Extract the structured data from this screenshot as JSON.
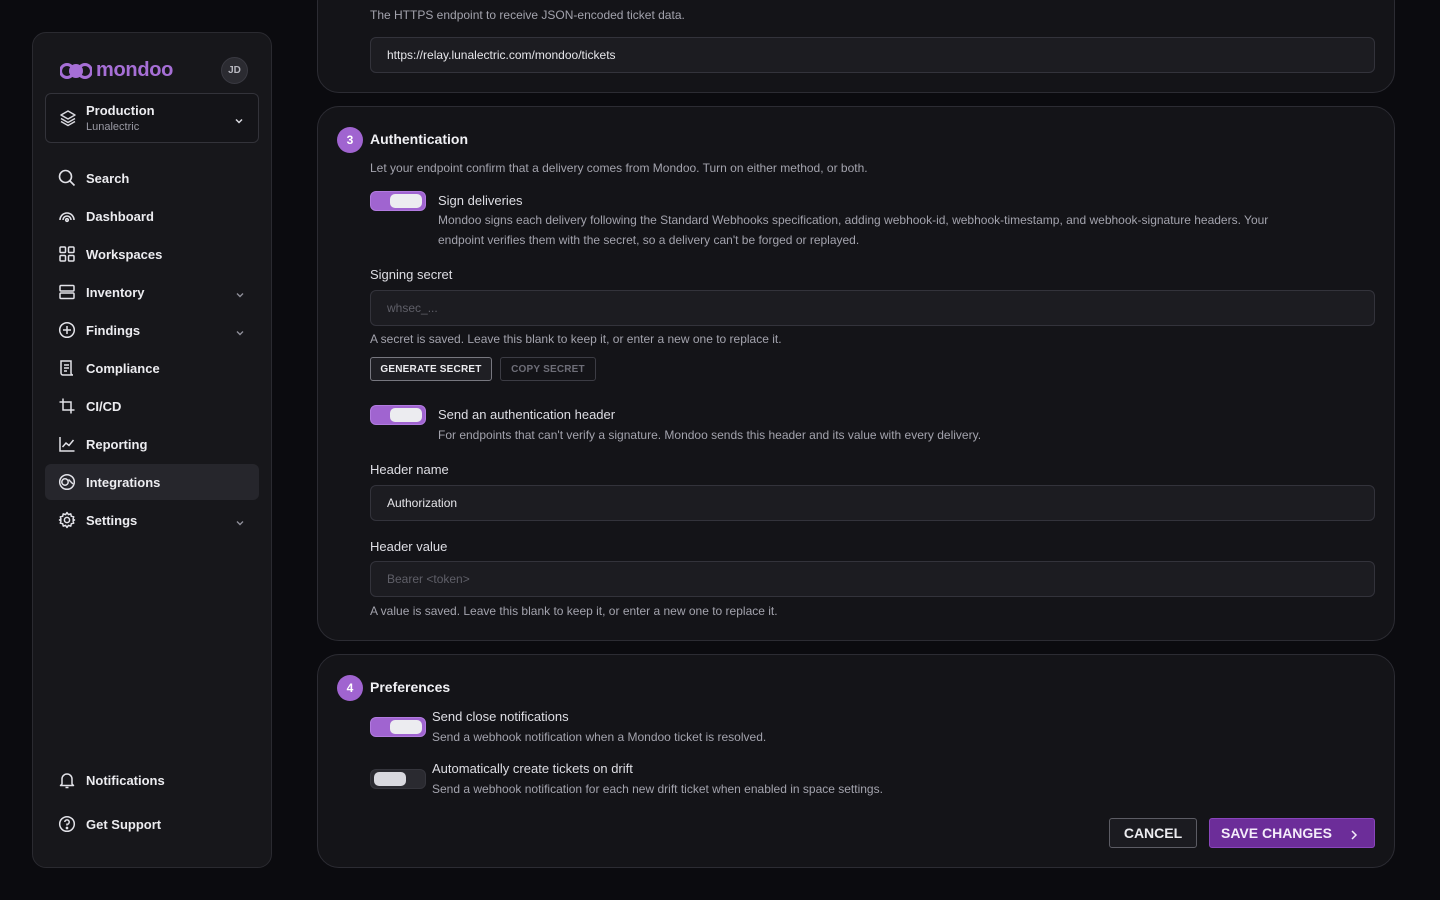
{
  "sidebar": {
    "logo_text": "mondoo",
    "avatar_initials": "JD",
    "space": {
      "name": "Production",
      "org": "Lunalectric"
    },
    "nav": [
      {
        "label": "Search",
        "icon": "search-icon"
      },
      {
        "label": "Dashboard",
        "icon": "dashboard-icon"
      },
      {
        "label": "Workspaces",
        "icon": "grid-icon"
      },
      {
        "label": "Inventory",
        "icon": "server-icon",
        "expandable": true
      },
      {
        "label": "Findings",
        "icon": "plus-circle-icon",
        "expandable": true
      },
      {
        "label": "Compliance",
        "icon": "scroll-icon"
      },
      {
        "label": "CI/CD",
        "icon": "pipeline-icon"
      },
      {
        "label": "Reporting",
        "icon": "line-chart-icon"
      },
      {
        "label": "Integrations",
        "icon": "integrations-icon",
        "active": true
      },
      {
        "label": "Settings",
        "icon": "gear-icon",
        "expandable": true
      }
    ],
    "bottom": [
      {
        "label": "Notifications",
        "icon": "bell-icon"
      },
      {
        "label": "Get Support",
        "icon": "help-circle-icon"
      }
    ]
  },
  "endpoint": {
    "hint": "The HTTPS endpoint to receive JSON-encoded ticket data.",
    "value": "https://relay.lunalectric.com/mondoo/tickets"
  },
  "authentication": {
    "step": "3",
    "title": "Authentication",
    "description": "Let your endpoint confirm that a delivery comes from Mondoo. Turn on either method, or both.",
    "sign": {
      "label": "Sign deliveries",
      "enabled": true,
      "description_line1": "Mondoo signs each delivery following the Standard Webhooks specification, adding webhook-id, webhook-timestamp, and webhook-signature headers. Your",
      "description_line2": "endpoint verifies them with the secret, so a delivery can't be forged or replayed."
    },
    "secret": {
      "label": "Signing secret",
      "placeholder": "whsec_...",
      "hint": "A secret is saved. Leave this blank to keep it, or enter a new one to replace it.",
      "generate_label": "GENERATE SECRET",
      "copy_label": "COPY SECRET"
    },
    "header_auth": {
      "label": "Send an authentication header",
      "enabled": true,
      "description": "For endpoints that can't verify a signature. Mondoo sends this header and its value with every delivery."
    },
    "header_name": {
      "label": "Header name",
      "value": "Authorization"
    },
    "header_value": {
      "label": "Header value",
      "placeholder": "Bearer <token>",
      "hint": "A value is saved. Leave this blank to keep it, or enter a new one to replace it."
    }
  },
  "preferences": {
    "step": "4",
    "title": "Preferences",
    "close_notifications": {
      "label": "Send close notifications",
      "enabled": true,
      "description": "Send a webhook notification when a Mondoo ticket is resolved."
    },
    "auto_create": {
      "label": "Automatically create tickets on drift",
      "enabled": false,
      "description": "Send a webhook notification for each new drift ticket when enabled in space settings."
    },
    "cancel_label": "CANCEL",
    "save_label": "SAVE CHANGES"
  },
  "colors": {
    "accent": "#a064d0",
    "save_button": "#6c2d99",
    "background": "#0b0b0f",
    "card": "#141418"
  }
}
